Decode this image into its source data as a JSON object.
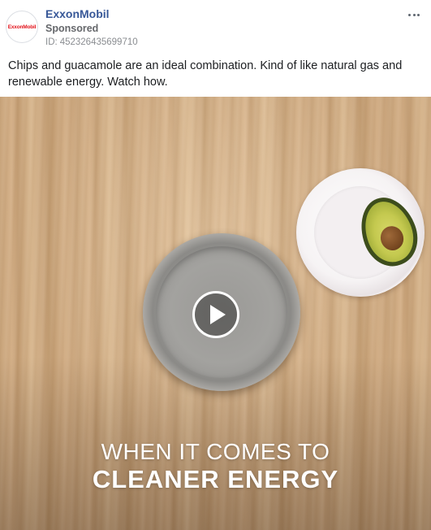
{
  "post": {
    "page_name": "ExxonMobil",
    "sponsored_label": "Sponsored",
    "ad_id_label": "ID:",
    "ad_id": "452326435699710",
    "avatar_logo_text": "ExxonMobil",
    "more_icon": "ellipsis-icon",
    "caption": "Chips and guacamole are an ideal combination. Kind of like natural gas and renewable energy. Watch how."
  },
  "video": {
    "overlay_line1": "WHEN IT COMES TO",
    "overlay_line2": "CLEANER ENERGY",
    "play_icon": "play-icon"
  },
  "colors": {
    "brand_link": "#385898",
    "brand_red": "#e3141c",
    "muted_text": "#65676b"
  }
}
